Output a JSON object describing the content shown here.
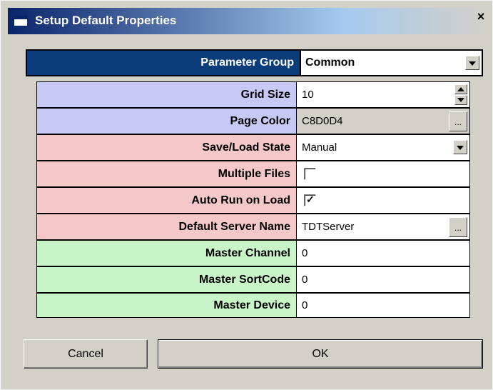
{
  "window": {
    "title": "Setup Default Properties",
    "close_label": "×"
  },
  "parameter_group": {
    "label": "Parameter Group",
    "value": "Common"
  },
  "properties": [
    {
      "label": "Grid Size",
      "value": "10"
    },
    {
      "label": "Page Color",
      "value": "C8D0D4",
      "button": "..."
    },
    {
      "label": "Save/Load State",
      "value": "Manual"
    },
    {
      "label": "Multiple Files",
      "checked": false
    },
    {
      "label": "Auto Run on Load",
      "checked": true,
      "check_glyph": "✓"
    },
    {
      "label": "Default Server Name",
      "value": "TDTServer",
      "button": "..."
    },
    {
      "label": "Master Channel",
      "value": "0"
    },
    {
      "label": "Master SortCode",
      "value": "0"
    },
    {
      "label": "Master Device",
      "value": "0"
    }
  ],
  "colors": {
    "title_bar": "#0a246a",
    "group_header": "#0b3c7a",
    "blue_row": "#c8c8f4",
    "red_row": "#f4c8c8",
    "green_row": "#c8f4c8"
  },
  "buttons": {
    "cancel": "Cancel",
    "ok": "OK"
  }
}
